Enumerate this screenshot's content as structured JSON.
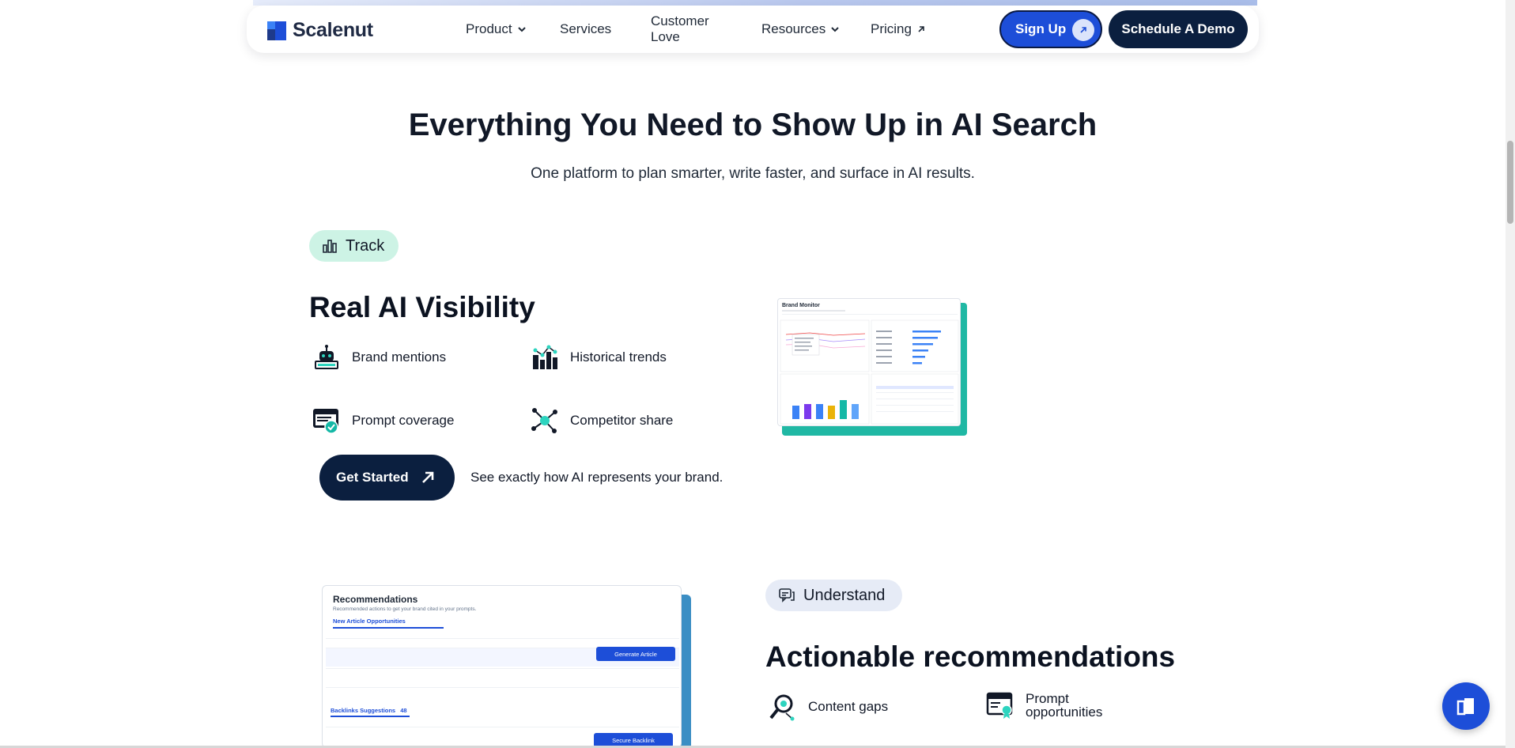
{
  "brand": {
    "name": "Scalenut",
    "colors": {
      "primary": "#1d4ed8",
      "navy": "#0b1f3f",
      "teal": "#20b8a4"
    }
  },
  "nav": {
    "items": [
      {
        "label": "Product",
        "icon": "chevron-down-icon"
      },
      {
        "label": "Services"
      },
      {
        "label": "Customer Love"
      },
      {
        "label": "Resources",
        "icon": "chevron-down-icon"
      },
      {
        "label": "Pricing",
        "icon": "arrow-up-right-icon"
      }
    ],
    "signup_label": "Sign Up",
    "demo_label": "Schedule A Demo"
  },
  "hero": {
    "title": "Everything You Need to Show Up in AI Search",
    "subtitle": "One platform to plan smarter, write faster, and surface in AI results."
  },
  "track": {
    "pill_label": "Track",
    "title": "Real AI Visibility",
    "features": [
      {
        "label": "Brand mentions",
        "icon": "robot-icon"
      },
      {
        "label": "Historical trends",
        "icon": "bar-chart-icon"
      },
      {
        "label": "Prompt coverage",
        "icon": "browser-check-icon"
      },
      {
        "label": "Competitor share",
        "icon": "network-icon"
      }
    ],
    "cta_label": "Get Started",
    "cta_note": "See exactly how AI represents your brand.",
    "screenshot": {
      "title": "Brand Monitor"
    }
  },
  "understand": {
    "pill_label": "Understand",
    "title": "Actionable recommendations",
    "features": [
      {
        "label": "Content gaps",
        "icon": "magnifier-icon"
      },
      {
        "label": "Prompt opportunities",
        "icon": "browser-badge-icon"
      }
    ],
    "screenshot": {
      "title": "Recommendations",
      "subtitle": "Recommended actions to get your brand cited in your prompts.",
      "tab": "New Article Opportunities",
      "generate_label": "Generate Article",
      "backlinks_label": "Backlinks Suggestions",
      "backlinks_count": "48",
      "secure_label": "Secure Backlink"
    }
  }
}
